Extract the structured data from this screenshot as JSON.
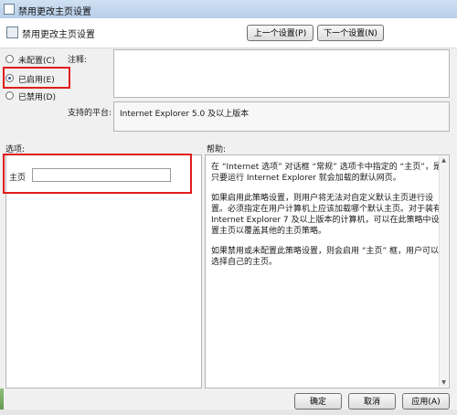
{
  "window": {
    "title": "禁用更改主页设置"
  },
  "header": {
    "policy_title": "禁用更改主页设置",
    "prev_button": "上一个设置(P)",
    "next_button": "下一个设置(N)"
  },
  "state": {
    "options": [
      {
        "label": "未配置(C)",
        "selected": false
      },
      {
        "label": "已启用(E)",
        "selected": true
      },
      {
        "label": "已禁用(D)",
        "selected": false
      }
    ]
  },
  "comment": {
    "label": "注释:",
    "value": ""
  },
  "platform": {
    "label": "支持的平台:",
    "value": "Internet Explorer 5.0 及以上版本"
  },
  "options_section": {
    "label": "选项:",
    "homepage_label": "主页",
    "homepage_value": ""
  },
  "help_section": {
    "label": "帮助:",
    "paragraphs": [
      "在 “Internet 选项” 对话框 “常规” 选项卡中指定的 “主页”，是只要运行 Internet Explorer 就会加载的默认网页。",
      "如果启用此策略设置，则用户将无法对自定义默认主页进行设置。必须指定在用户计算机上应该加载哪个默认主页。对于装有 Internet Explorer 7 及以上版本的计算机，可以在此策略中设置主页以覆盖其他的主页策略。",
      "如果禁用或未配置此策略设置，则会启用 “主页” 框，用户可以选择自己的主页。"
    ]
  },
  "footer": {
    "ok": "确定",
    "cancel": "取消",
    "apply": "应用(A)"
  },
  "colors": {
    "highlight": "#e11d1d",
    "titlebar": "#cfe0f3"
  }
}
